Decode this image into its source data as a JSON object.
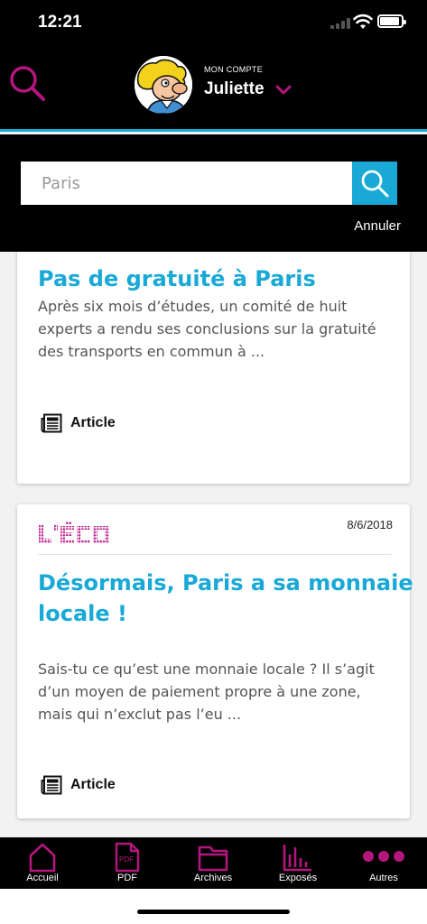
{
  "status": {
    "time": "12:21"
  },
  "header": {
    "account_caption": "MON COMPTE",
    "account_name": "Juliette"
  },
  "search": {
    "placeholder": "Paris",
    "cancel_label": "Annuler"
  },
  "results": [
    {
      "title": "Pas de gratuité à Paris",
      "excerpt": "Après six mois d’études, un comité de huit experts a rendu ses conclusions sur la gratuité des transports en commun à ...",
      "type_label": "Article"
    },
    {
      "brand": "L'ÉCO",
      "date": "8/6/2018",
      "title": "Désormais, Paris a sa monnaie locale !",
      "excerpt": "Sais-tu ce qu’est une monnaie locale ? Il s’agit d’un moyen de paiement propre à une zone, mais qui n’exclut pas l’eu ...",
      "type_label": "Article"
    }
  ],
  "tabbar": {
    "tabs": [
      {
        "label": "Accueil",
        "icon": "home-icon"
      },
      {
        "label": "PDF",
        "icon": "pdf-icon",
        "icon_text": "PDF"
      },
      {
        "label": "Archives",
        "icon": "folder-icon"
      },
      {
        "label": "Exposés",
        "icon": "chart-icon"
      },
      {
        "label": "Autres",
        "icon": "more-icon"
      }
    ]
  },
  "colors": {
    "accent_magenta": "#b5157f",
    "accent_cyan": "#19a9d6",
    "brand_pink": "#c0248f"
  }
}
